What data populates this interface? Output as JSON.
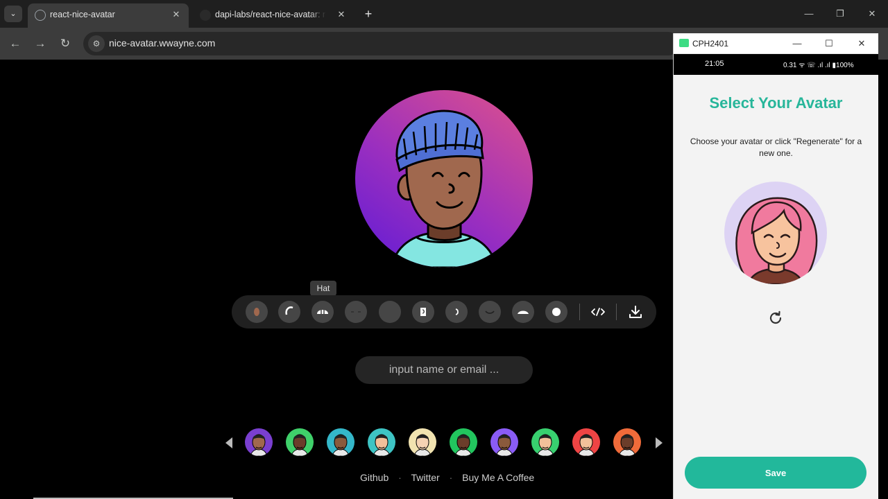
{
  "browser": {
    "tabs": [
      {
        "title": "react-nice-avatar",
        "active": true
      },
      {
        "title": "dapi-labs/react-nice-avatar: react",
        "active": false
      }
    ],
    "url": "nice-avatar.wwayne.com"
  },
  "editor": {
    "tooltip": "Hat",
    "options": [
      {
        "name": "face",
        "icon": "face-icon"
      },
      {
        "name": "hair",
        "icon": "hair-icon"
      },
      {
        "name": "hat",
        "icon": "hat-icon"
      },
      {
        "name": "eyes",
        "icon": "eyes-icon"
      },
      {
        "name": "glasses",
        "icon": "glasses-icon"
      },
      {
        "name": "ear",
        "icon": "ear-icon"
      },
      {
        "name": "nose",
        "icon": "nose-icon"
      },
      {
        "name": "mouth",
        "icon": "mouth-icon"
      },
      {
        "name": "shirt",
        "icon": "shirt-icon"
      },
      {
        "name": "background",
        "icon": "background-icon"
      }
    ],
    "code_icon": "code-icon",
    "download_icon": "download-icon"
  },
  "name_input": {
    "placeholder": "input name or email ..."
  },
  "gallery": {
    "thumbnail_backgrounds": [
      "#7a3fd0",
      "#3fd06a",
      "#34b7c9",
      "#3ec4c4",
      "#f1e3b0",
      "#22c55e",
      "#8a5cf6",
      "#38d06f",
      "#ef4444",
      "#f06b3a"
    ]
  },
  "footer": {
    "links": [
      "Github",
      "Twitter",
      "Buy Me A Coffee"
    ],
    "separator": "·"
  },
  "phone_window": {
    "title": "CPH2401",
    "status_time": "21:05",
    "status_icons": "0.31 ᯤ ☏ .ıl .ıl ▮100%",
    "app_title": "Select Your Avatar",
    "app_subtitle": "Choose your avatar or click \"Regenerate\" for a new one.",
    "save_label": "Save"
  },
  "colors": {
    "accent": "#22b89b",
    "avatar_bg_start": "#5f1bd6",
    "avatar_bg_end": "#e0528a",
    "skin": "#a0684e",
    "hat": "#5b7fe0",
    "shirt": "#84e6e1"
  }
}
